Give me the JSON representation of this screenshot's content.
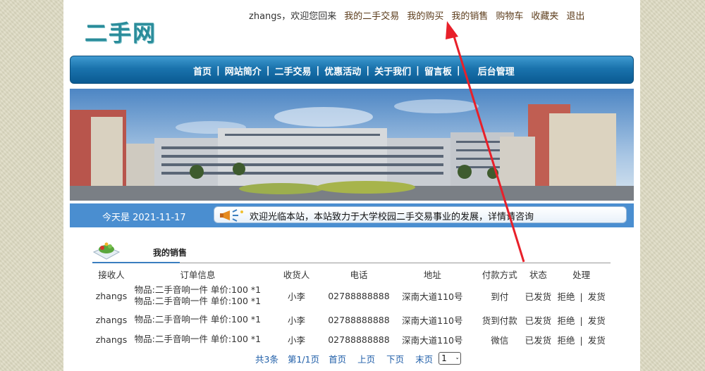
{
  "logo": {
    "text": "二手网"
  },
  "top_links": {
    "welcome": "zhangs，欢迎您回来",
    "items": [
      "我的二手交易",
      "我的购买",
      "我的销售",
      "购物车",
      "收藏夹",
      "退出"
    ]
  },
  "nav": {
    "items": [
      "首页",
      "网站简介",
      "二手交易",
      "优惠活动",
      "关于我们",
      "留言板",
      "后台管理"
    ],
    "separator": "|"
  },
  "info_bar": {
    "date_text": "今天是 2021-11-17",
    "notice": "欢迎光临本站，本站致力于大学校园二手交易事业的发展，详情请咨询"
  },
  "section": {
    "title": "我的销售"
  },
  "table": {
    "headers": [
      "接收人",
      "订单信息",
      "收货人",
      "电话",
      "地址",
      "付款方式",
      "状态",
      "处理"
    ],
    "rows": [
      {
        "receiver": "zhangs",
        "goods": [
          "物品:二手音响一件 单价:100 *1",
          "物品:二手音响一件 单价:100 *1"
        ],
        "consignee": "小李",
        "phone": "02788888888",
        "address": "深南大道110号",
        "payment": "到付",
        "status": "已发货",
        "reject": "拒绝",
        "ship": "发货"
      },
      {
        "receiver": "zhangs",
        "goods": [
          "物品:二手音响一件 单价:100 *1"
        ],
        "consignee": "小李",
        "phone": "02788888888",
        "address": "深南大道110号",
        "payment": "货到付款",
        "status": "已发货",
        "reject": "拒绝",
        "ship": "发货"
      },
      {
        "receiver": "zhangs",
        "goods": [
          "物品:二手音响一件 单价:100 *1"
        ],
        "consignee": "小李",
        "phone": "02788888888",
        "address": "深南大道110号",
        "payment": "微信",
        "status": "已发货",
        "reject": "拒绝",
        "ship": "发货"
      }
    ],
    "op_separator": "|"
  },
  "pager": {
    "total": "共3条",
    "page": "第1/1页",
    "first": "首页",
    "prev": "上页",
    "next": "下页",
    "last": "末页",
    "select_value": "1"
  },
  "colors": {
    "nav_blue": "#1a73ad",
    "info_blue": "#4a8ed0",
    "annotation_red": "#e8202a",
    "logo_teal": "#2a8c9a"
  }
}
